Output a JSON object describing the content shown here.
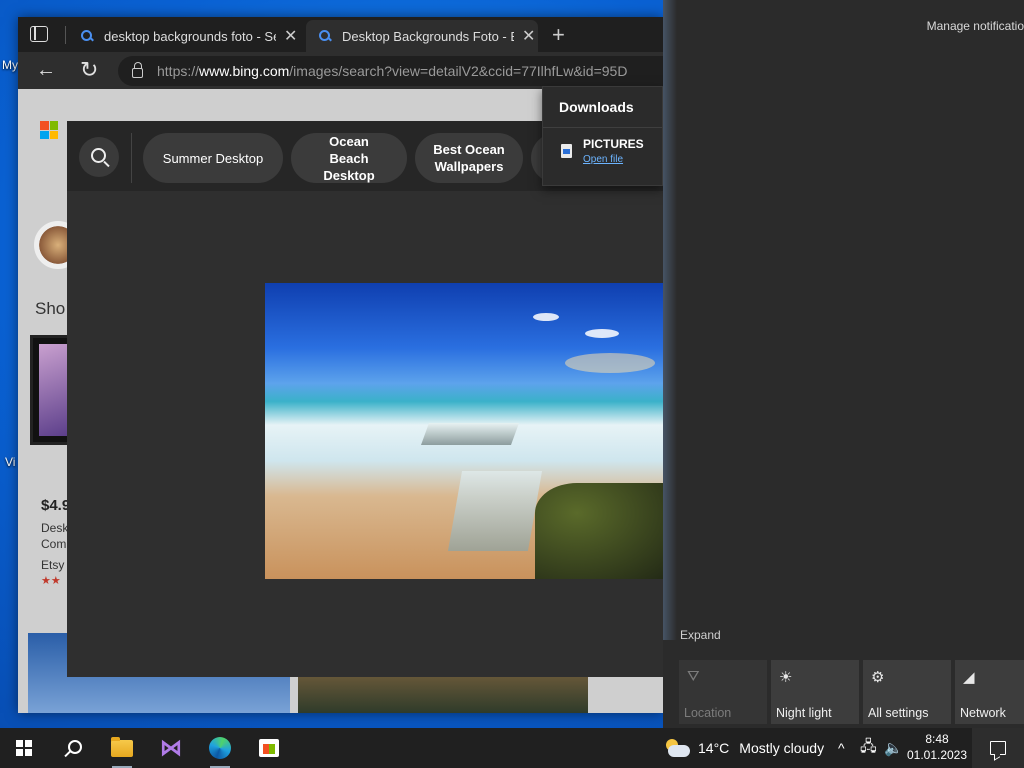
{
  "desktop": {
    "labels": [
      "My",
      "Vi"
    ]
  },
  "browser": {
    "tabs": [
      {
        "title": "desktop backgrounds foto - Sear",
        "close": "✕"
      },
      {
        "title": "Desktop Backgrounds Foto - Bin",
        "close": "✕"
      }
    ],
    "new_tab": "+",
    "back": "←",
    "refresh": "↻",
    "url_prefix": "https://",
    "url_domain": "www.bing.com",
    "url_path": "/images/search?view=detailV2&ccid=77IlhfLw&id=95D"
  },
  "page": {
    "sho": "Sho",
    "price": "$4.9",
    "desc1": "Desk",
    "desc2": "Com",
    "store": "Etsy",
    "stars": "★★"
  },
  "viewer": {
    "chips": [
      {
        "label": "Summer Desktop"
      },
      {
        "label": "Ocean Beach Desktop"
      },
      {
        "label": "Best Ocean Wallpapers"
      }
    ]
  },
  "downloads": {
    "title": "Downloads",
    "file_name": "PICTURES",
    "open_file": "Open file"
  },
  "action_center": {
    "manage": "Manage notificatio",
    "expand": "Expand",
    "tiles": [
      {
        "label": "Location",
        "icon": "location-icon",
        "glyph": "⛛",
        "enabled": false
      },
      {
        "label": "Night light",
        "icon": "sun-icon",
        "glyph": "☀",
        "enabled": true
      },
      {
        "label": "All settings",
        "icon": "gear-icon",
        "glyph": "⚙",
        "enabled": true
      },
      {
        "label": "Network",
        "icon": "network-icon",
        "glyph": "◢",
        "enabled": true
      }
    ]
  },
  "taskbar": {
    "weather_temp": "14°C",
    "weather_desc": "Mostly cloudy",
    "chevron": "^",
    "time": "8:48",
    "date": "01.01.2023"
  },
  "colors": {
    "accent": "#0078d4",
    "desktop_blue": "#0a62d4",
    "link_blue": "#6cb4ff"
  }
}
